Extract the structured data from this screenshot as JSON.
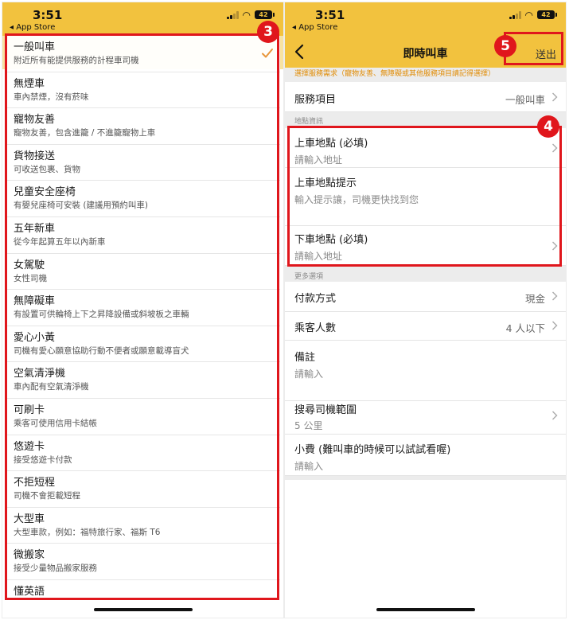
{
  "status": {
    "time": "3:51",
    "back_app": "◂ App Store",
    "battery": "42"
  },
  "left": {
    "options": [
      {
        "title": "一般叫車",
        "desc": "附近所有能提供服務的計程車司機",
        "selected": true
      },
      {
        "title": "無煙車",
        "desc": "車內禁煙，沒有菸味"
      },
      {
        "title": "寵物友善",
        "desc": "寵物友善，包含進籠 / 不進籠寵物上車"
      },
      {
        "title": "貨物接送",
        "desc": "可收送包裹、貨物"
      },
      {
        "title": "兒童安全座椅",
        "desc": "有嬰兒座椅可安裝 (建議用預約叫車)"
      },
      {
        "title": "五年新車",
        "desc": "從今年起算五年以內新車"
      },
      {
        "title": "女駕駛",
        "desc": "女性司機"
      },
      {
        "title": "無障礙車",
        "desc": "有設置可供輪椅上下之昇降設備或斜坡板之車輛"
      },
      {
        "title": "愛心小黃",
        "desc": "司機有愛心願意協助行動不便者或願意載導盲犬"
      },
      {
        "title": "空氣清淨機",
        "desc": "車內配有空氣清淨機"
      },
      {
        "title": "可刷卡",
        "desc": "乘客可使用信用卡結帳"
      },
      {
        "title": "悠遊卡",
        "desc": "接受悠遊卡付款"
      },
      {
        "title": "不拒短程",
        "desc": "司機不會拒載短程"
      },
      {
        "title": "大型車",
        "desc": "大型車款，例如：福特旅行家、福斯 T6"
      },
      {
        "title": "微搬家",
        "desc": "接受少量物品搬家服務"
      },
      {
        "title": "懂英語",
        "desc": ""
      }
    ]
  },
  "right": {
    "nav_title": "即時叫車",
    "send_label": "送出",
    "service_hint": "選擇服務需求（寵物友善、無障礙或其他服務項目請記得選擇）",
    "service": {
      "label": "服務項目",
      "value": "一般叫車"
    },
    "location_header": "地點資訊",
    "pickup": {
      "label": "上車地點 (必填)",
      "placeholder": "請輸入地址"
    },
    "pickup_hint": {
      "label": "上車地點提示",
      "placeholder": "輸入提示讓，司機更快找到您"
    },
    "dropoff": {
      "label": "下車地點 (必填)",
      "placeholder": "請輸入地址"
    },
    "more_header": "更多選項",
    "payment": {
      "label": "付款方式",
      "value": "現金"
    },
    "passengers": {
      "label": "乘客人數",
      "value": "4 人以下"
    },
    "note": {
      "label": "備註",
      "placeholder": "請輸入"
    },
    "range": {
      "label": "搜尋司機範圍",
      "value": "5 公里"
    },
    "tip": {
      "label": "小費 (難叫車的時候可以試試看喔)",
      "placeholder": "請輸入"
    }
  },
  "annotations": {
    "badge_3": "3",
    "badge_4": "4",
    "badge_5": "5"
  },
  "colors": {
    "brand_yellow": "#f2c23e",
    "highlight_red": "#e0161c",
    "hint_orange": "#e08a00"
  }
}
